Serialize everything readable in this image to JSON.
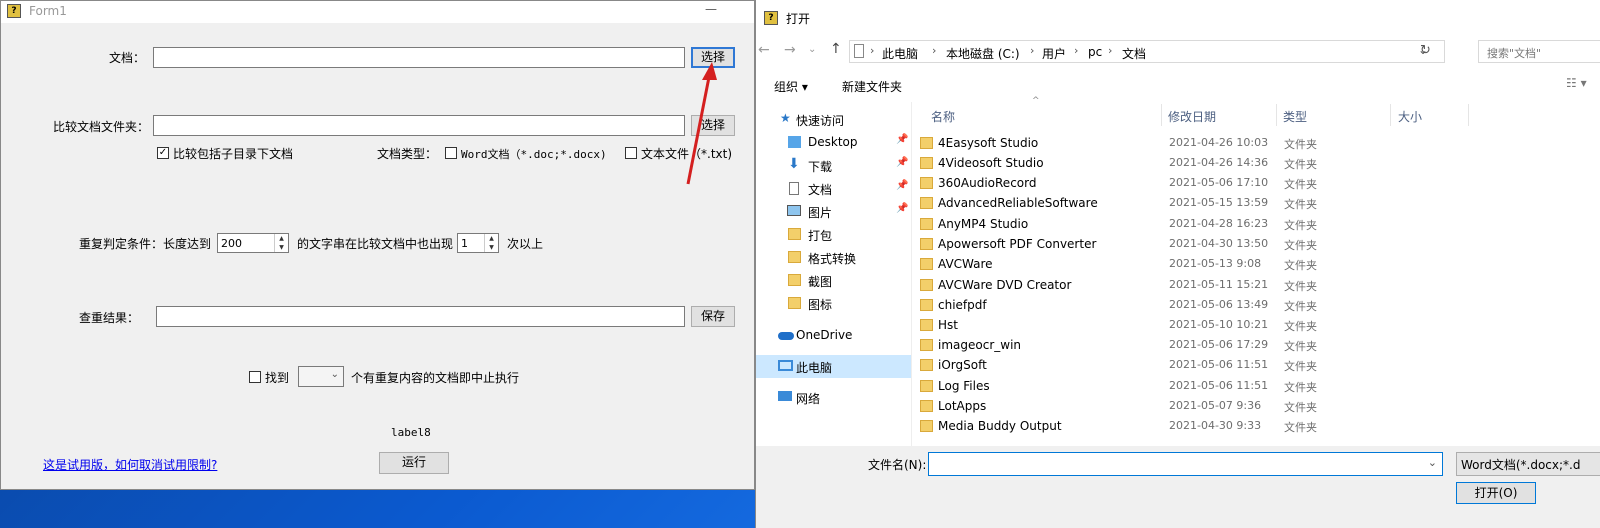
{
  "form1": {
    "title": "Form1",
    "doc_label": "文档：",
    "doc_value": "",
    "select_button": "选择",
    "compare_label": "比较文档文件夹：",
    "compare_value": "",
    "compare_select_button": "选择",
    "include_subdirs_label": "比较包括子目录下文档",
    "include_subdirs_checked": true,
    "doc_type_label": "文档类型：",
    "word_doc_label": "Word文档（*.doc;*.docx)",
    "word_doc_checked": false,
    "txt_label": "文本文件（*.txt)",
    "txt_checked": false,
    "condition_label": "重复判定条件：长度达到",
    "length_value": "200",
    "middle_text": "的文字串在比较文档中也出现",
    "count_value": "1",
    "suffix_text": "次以上",
    "result_label": "查重结果：",
    "result_value": "",
    "save_button": "保存",
    "stop_prefix": "找到",
    "stop_checked": false,
    "stop_value": "",
    "stop_suffix": "个有重复内容的文档即中止执行",
    "label8": "label8",
    "trial_link": "这是试用版，如何取消试用限制?",
    "run_button": "运行"
  },
  "dialog": {
    "title": "打开",
    "breadcrumb": [
      "此电脑",
      "本地磁盘 (C:)",
      "用户",
      "pc",
      "文档"
    ],
    "search_placeholder": "搜索\"文档\"",
    "organize_label": "组织 ▾",
    "new_folder_label": "新建文件夹",
    "sidebar": {
      "quick_access": "快速访问",
      "items": [
        {
          "label": "Desktop",
          "icon": "folder-blue-icon",
          "pinned": true
        },
        {
          "label": "下载",
          "icon": "download-icon",
          "pinned": true
        },
        {
          "label": "文档",
          "icon": "document-icon",
          "pinned": true
        },
        {
          "label": "图片",
          "icon": "picture-icon",
          "pinned": true
        },
        {
          "label": "打包",
          "icon": "folder-icon",
          "pinned": false
        },
        {
          "label": "格式转换",
          "icon": "folder-icon",
          "pinned": false
        },
        {
          "label": "截图",
          "icon": "folder-icon",
          "pinned": false
        },
        {
          "label": "图标",
          "icon": "folder-icon",
          "pinned": false
        }
      ],
      "onedrive": "OneDrive",
      "this_pc": "此电脑",
      "network": "网络"
    },
    "columns": {
      "name": "名称",
      "modified": "修改日期",
      "type": "类型",
      "size": "大小"
    },
    "files": [
      {
        "name": "4Easysoft Studio",
        "date": "2021-04-26 10:03",
        "type": "文件夹"
      },
      {
        "name": "4Videosoft Studio",
        "date": "2021-04-26 14:36",
        "type": "文件夹"
      },
      {
        "name": "360AudioRecord",
        "date": "2021-05-06 17:10",
        "type": "文件夹"
      },
      {
        "name": "AdvancedReliableSoftware",
        "date": "2021-05-15 13:59",
        "type": "文件夹"
      },
      {
        "name": "AnyMP4 Studio",
        "date": "2021-04-28 16:23",
        "type": "文件夹"
      },
      {
        "name": "Apowersoft PDF Converter",
        "date": "2021-04-30 13:50",
        "type": "文件夹"
      },
      {
        "name": "AVCWare",
        "date": "2021-05-13 9:08",
        "type": "文件夹"
      },
      {
        "name": "AVCWare DVD Creator",
        "date": "2021-05-11 15:21",
        "type": "文件夹"
      },
      {
        "name": "chiefpdf",
        "date": "2021-05-06 13:49",
        "type": "文件夹"
      },
      {
        "name": "Hst",
        "date": "2021-05-10 10:21",
        "type": "文件夹"
      },
      {
        "name": "imageocr_win",
        "date": "2021-05-06 17:29",
        "type": "文件夹"
      },
      {
        "name": "iOrgSoft",
        "date": "2021-05-06 11:51",
        "type": "文件夹"
      },
      {
        "name": "Log Files",
        "date": "2021-05-06 11:51",
        "type": "文件夹"
      },
      {
        "name": "LotApps",
        "date": "2021-05-07 9:36",
        "type": "文件夹"
      },
      {
        "name": "Media Buddy Output",
        "date": "2021-04-30 9:33",
        "type": "文件夹"
      }
    ],
    "filename_label": "文件名(N):",
    "filename_value": "",
    "filter_value": "Word文档(*.docx;*.d",
    "open_button": "打开(O)"
  },
  "colors": {
    "accent": "#0078d7",
    "selected": "#cce8ff",
    "arrow": "#d42020",
    "folder": "#f3cf6a"
  }
}
